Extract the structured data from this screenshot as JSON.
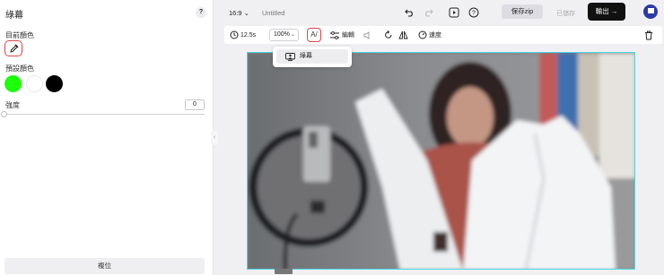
{
  "panel": {
    "title": "綠幕",
    "help": "?",
    "current_color_label": "目前顏色",
    "preset_color_label": "預設顏色",
    "strength_label": "強度",
    "strength_value": "0",
    "strength_level": 0,
    "reset_label": "複位",
    "preset_colors": [
      "#1bff0a",
      "#ffffff",
      "#000000"
    ]
  },
  "topbar": {
    "aspect_ratio": "16:9 ⌄",
    "document_title": "Untitled",
    "save_zip_label": "保存zip",
    "saved_label": "已儲存",
    "export_label": "輸出 →"
  },
  "toolbar": {
    "duration": "12.5s",
    "zoom": "100%",
    "zoom_caret": "⌄",
    "ai_label": "A/",
    "edit_label": "編輯",
    "speed_label": "速度"
  },
  "dropdown": {
    "item_label": "綠幕"
  },
  "colors": {
    "accent_red": "#e04444",
    "canvas_border": "#4fd6e0",
    "export_bg": "#111111"
  }
}
